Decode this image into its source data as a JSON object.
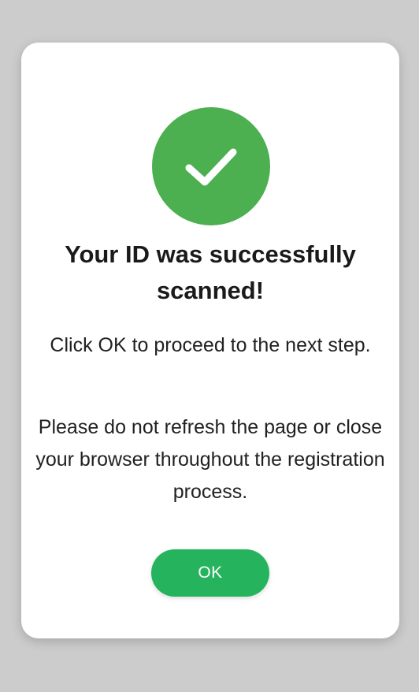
{
  "dialog": {
    "icon": "checkmark-icon",
    "title": "Your ID was successfully scanned!",
    "instruction": "Click OK to proceed to the next step.",
    "warning": "Please do not refresh the page or close your browser throughout the registration process.",
    "ok_label": "OK"
  },
  "colors": {
    "background": "#cccccc",
    "dialog_background": "#ffffff",
    "success_badge": "#4caf50",
    "ok_button": "#25b35d",
    "text": "#212121"
  }
}
